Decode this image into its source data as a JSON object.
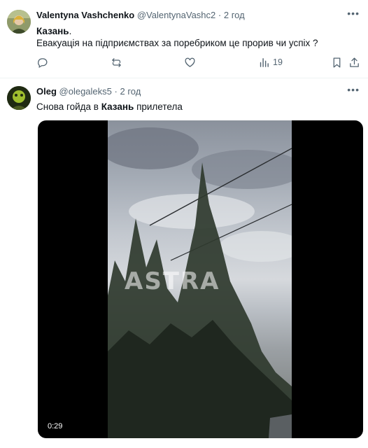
{
  "tweets": [
    {
      "name": "Valentyna Vashchenko",
      "handle": "@ValentynaVashc2",
      "separator": "·",
      "time": "2 год",
      "text_line1_bold": "Казань",
      "text_line1_rest": ".",
      "text_line2": "Евакуація на підприємствах за поребриком це прорив чи успіх ?",
      "views": "19"
    },
    {
      "name": "Oleg",
      "handle": "@olegaleks5",
      "separator": "·",
      "time": "2 год",
      "text_before": "Снова гойда в ",
      "text_bold": "Казань",
      "text_after": " прилетела",
      "video": {
        "duration": "0:29",
        "watermark": "ASTRA"
      }
    }
  ],
  "icons": {
    "more": "more-icon",
    "reply": "reply-icon",
    "retweet": "retweet-icon",
    "like": "like-icon",
    "views": "views-icon",
    "bookmark": "bookmark-icon",
    "share": "share-icon"
  },
  "colors": {
    "secondary_text": "#536471",
    "divider": "#eff3f4"
  }
}
